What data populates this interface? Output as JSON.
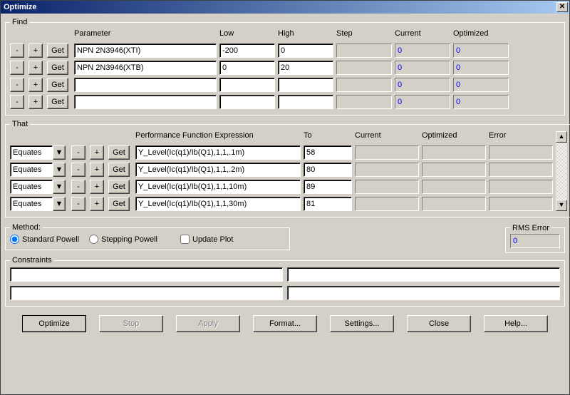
{
  "window": {
    "title": "Optimize"
  },
  "find": {
    "legend": "Find",
    "headers": {
      "parameter": "Parameter",
      "low": "Low",
      "high": "High",
      "step": "Step",
      "current": "Current",
      "optimized": "Optimized"
    },
    "minus": "-",
    "plus": "+",
    "get": "Get",
    "rows": [
      {
        "parameter": "NPN 2N3946(XTI)",
        "low": "-200",
        "high": "0",
        "step": "",
        "current": "0",
        "optimized": "0"
      },
      {
        "parameter": "NPN 2N3946(XTB)",
        "low": "0",
        "high": "20",
        "step": "",
        "current": "0",
        "optimized": "0"
      },
      {
        "parameter": "",
        "low": "",
        "high": "",
        "step": "",
        "current": "0",
        "optimized": "0"
      },
      {
        "parameter": "",
        "low": "",
        "high": "",
        "step": "",
        "current": "0",
        "optimized": "0"
      }
    ]
  },
  "that": {
    "legend": "That",
    "headers": {
      "expr": "Performance Function Expression",
      "to": "To",
      "current": "Current",
      "optimized": "Optimized",
      "error": "Error"
    },
    "mode": "Equates",
    "minus": "-",
    "plus": "+",
    "get": "Get",
    "rows": [
      {
        "expr": "Y_Level(Ic(q1)/Ib(Q1),1,1,.1m)",
        "to": "58",
        "current": "",
        "optimized": "",
        "error": ""
      },
      {
        "expr": "Y_Level(Ic(q1)/Ib(Q1),1,1,.2m)",
        "to": "80",
        "current": "",
        "optimized": "",
        "error": ""
      },
      {
        "expr": "Y_Level(Ic(q1)/Ib(Q1),1,1,10m)",
        "to": "89",
        "current": "",
        "optimized": "",
        "error": ""
      },
      {
        "expr": "Y_Level(Ic(q1)/Ib(Q1),1,1,30m)",
        "to": "81",
        "current": "",
        "optimized": "",
        "error": ""
      }
    ]
  },
  "method": {
    "legend": "Method:",
    "standard": "Standard Powell",
    "stepping": "Stepping Powell",
    "update": "Update Plot",
    "rms_legend": "RMS Error",
    "rms_value": "0"
  },
  "constraints": {
    "legend": "Constraints",
    "c1": "",
    "c2": "",
    "c3": "",
    "c4": ""
  },
  "footer": {
    "optimize": "Optimize",
    "stop": "Stop",
    "apply": "Apply",
    "format": "Format...",
    "settings": "Settings...",
    "close": "Close",
    "help": "Help..."
  },
  "icons": {
    "dropdown": "▼",
    "up": "▲",
    "down": "▼",
    "close": "✕"
  }
}
